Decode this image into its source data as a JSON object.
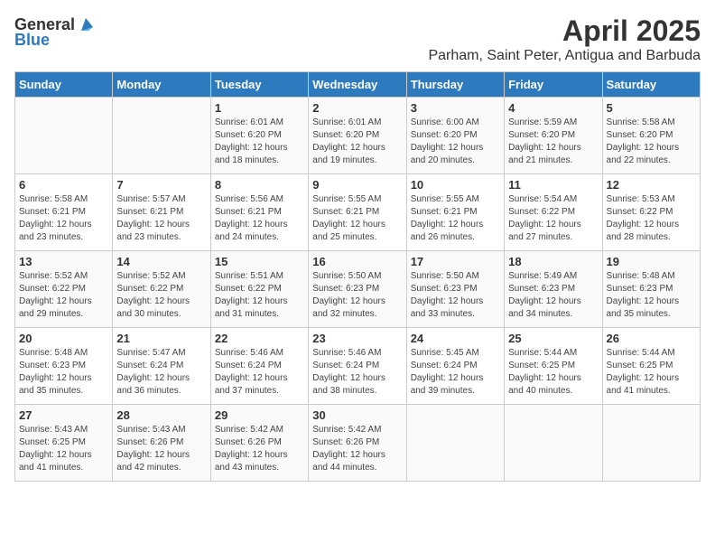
{
  "header": {
    "logo_general": "General",
    "logo_blue": "Blue",
    "month_title": "April 2025",
    "location": "Parham, Saint Peter, Antigua and Barbuda"
  },
  "days_of_week": [
    "Sunday",
    "Monday",
    "Tuesday",
    "Wednesday",
    "Thursday",
    "Friday",
    "Saturday"
  ],
  "weeks": [
    [
      {
        "day": "",
        "sunrise": "",
        "sunset": "",
        "daylight": ""
      },
      {
        "day": "",
        "sunrise": "",
        "sunset": "",
        "daylight": ""
      },
      {
        "day": "1",
        "sunrise": "Sunrise: 6:01 AM",
        "sunset": "Sunset: 6:20 PM",
        "daylight": "Daylight: 12 hours and 18 minutes."
      },
      {
        "day": "2",
        "sunrise": "Sunrise: 6:01 AM",
        "sunset": "Sunset: 6:20 PM",
        "daylight": "Daylight: 12 hours and 19 minutes."
      },
      {
        "day": "3",
        "sunrise": "Sunrise: 6:00 AM",
        "sunset": "Sunset: 6:20 PM",
        "daylight": "Daylight: 12 hours and 20 minutes."
      },
      {
        "day": "4",
        "sunrise": "Sunrise: 5:59 AM",
        "sunset": "Sunset: 6:20 PM",
        "daylight": "Daylight: 12 hours and 21 minutes."
      },
      {
        "day": "5",
        "sunrise": "Sunrise: 5:58 AM",
        "sunset": "Sunset: 6:20 PM",
        "daylight": "Daylight: 12 hours and 22 minutes."
      }
    ],
    [
      {
        "day": "6",
        "sunrise": "Sunrise: 5:58 AM",
        "sunset": "Sunset: 6:21 PM",
        "daylight": "Daylight: 12 hours and 23 minutes."
      },
      {
        "day": "7",
        "sunrise": "Sunrise: 5:57 AM",
        "sunset": "Sunset: 6:21 PM",
        "daylight": "Daylight: 12 hours and 23 minutes."
      },
      {
        "day": "8",
        "sunrise": "Sunrise: 5:56 AM",
        "sunset": "Sunset: 6:21 PM",
        "daylight": "Daylight: 12 hours and 24 minutes."
      },
      {
        "day": "9",
        "sunrise": "Sunrise: 5:55 AM",
        "sunset": "Sunset: 6:21 PM",
        "daylight": "Daylight: 12 hours and 25 minutes."
      },
      {
        "day": "10",
        "sunrise": "Sunrise: 5:55 AM",
        "sunset": "Sunset: 6:21 PM",
        "daylight": "Daylight: 12 hours and 26 minutes."
      },
      {
        "day": "11",
        "sunrise": "Sunrise: 5:54 AM",
        "sunset": "Sunset: 6:22 PM",
        "daylight": "Daylight: 12 hours and 27 minutes."
      },
      {
        "day": "12",
        "sunrise": "Sunrise: 5:53 AM",
        "sunset": "Sunset: 6:22 PM",
        "daylight": "Daylight: 12 hours and 28 minutes."
      }
    ],
    [
      {
        "day": "13",
        "sunrise": "Sunrise: 5:52 AM",
        "sunset": "Sunset: 6:22 PM",
        "daylight": "Daylight: 12 hours and 29 minutes."
      },
      {
        "day": "14",
        "sunrise": "Sunrise: 5:52 AM",
        "sunset": "Sunset: 6:22 PM",
        "daylight": "Daylight: 12 hours and 30 minutes."
      },
      {
        "day": "15",
        "sunrise": "Sunrise: 5:51 AM",
        "sunset": "Sunset: 6:22 PM",
        "daylight": "Daylight: 12 hours and 31 minutes."
      },
      {
        "day": "16",
        "sunrise": "Sunrise: 5:50 AM",
        "sunset": "Sunset: 6:23 PM",
        "daylight": "Daylight: 12 hours and 32 minutes."
      },
      {
        "day": "17",
        "sunrise": "Sunrise: 5:50 AM",
        "sunset": "Sunset: 6:23 PM",
        "daylight": "Daylight: 12 hours and 33 minutes."
      },
      {
        "day": "18",
        "sunrise": "Sunrise: 5:49 AM",
        "sunset": "Sunset: 6:23 PM",
        "daylight": "Daylight: 12 hours and 34 minutes."
      },
      {
        "day": "19",
        "sunrise": "Sunrise: 5:48 AM",
        "sunset": "Sunset: 6:23 PM",
        "daylight": "Daylight: 12 hours and 35 minutes."
      }
    ],
    [
      {
        "day": "20",
        "sunrise": "Sunrise: 5:48 AM",
        "sunset": "Sunset: 6:23 PM",
        "daylight": "Daylight: 12 hours and 35 minutes."
      },
      {
        "day": "21",
        "sunrise": "Sunrise: 5:47 AM",
        "sunset": "Sunset: 6:24 PM",
        "daylight": "Daylight: 12 hours and 36 minutes."
      },
      {
        "day": "22",
        "sunrise": "Sunrise: 5:46 AM",
        "sunset": "Sunset: 6:24 PM",
        "daylight": "Daylight: 12 hours and 37 minutes."
      },
      {
        "day": "23",
        "sunrise": "Sunrise: 5:46 AM",
        "sunset": "Sunset: 6:24 PM",
        "daylight": "Daylight: 12 hours and 38 minutes."
      },
      {
        "day": "24",
        "sunrise": "Sunrise: 5:45 AM",
        "sunset": "Sunset: 6:24 PM",
        "daylight": "Daylight: 12 hours and 39 minutes."
      },
      {
        "day": "25",
        "sunrise": "Sunrise: 5:44 AM",
        "sunset": "Sunset: 6:25 PM",
        "daylight": "Daylight: 12 hours and 40 minutes."
      },
      {
        "day": "26",
        "sunrise": "Sunrise: 5:44 AM",
        "sunset": "Sunset: 6:25 PM",
        "daylight": "Daylight: 12 hours and 41 minutes."
      }
    ],
    [
      {
        "day": "27",
        "sunrise": "Sunrise: 5:43 AM",
        "sunset": "Sunset: 6:25 PM",
        "daylight": "Daylight: 12 hours and 41 minutes."
      },
      {
        "day": "28",
        "sunrise": "Sunrise: 5:43 AM",
        "sunset": "Sunset: 6:26 PM",
        "daylight": "Daylight: 12 hours and 42 minutes."
      },
      {
        "day": "29",
        "sunrise": "Sunrise: 5:42 AM",
        "sunset": "Sunset: 6:26 PM",
        "daylight": "Daylight: 12 hours and 43 minutes."
      },
      {
        "day": "30",
        "sunrise": "Sunrise: 5:42 AM",
        "sunset": "Sunset: 6:26 PM",
        "daylight": "Daylight: 12 hours and 44 minutes."
      },
      {
        "day": "",
        "sunrise": "",
        "sunset": "",
        "daylight": ""
      },
      {
        "day": "",
        "sunrise": "",
        "sunset": "",
        "daylight": ""
      },
      {
        "day": "",
        "sunrise": "",
        "sunset": "",
        "daylight": ""
      }
    ]
  ]
}
